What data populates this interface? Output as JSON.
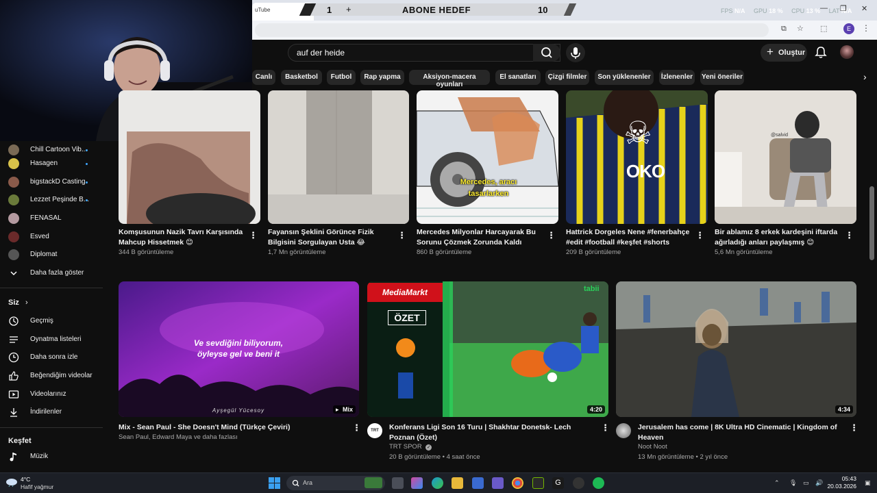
{
  "browser": {
    "tab_title": "uTube",
    "overlay": {
      "left_number": "1",
      "plus": "+",
      "title": "ABONE HEDEF",
      "right_number": "10"
    },
    "stats": [
      {
        "label": "FPS",
        "value": "N/A"
      },
      {
        "label": "GPU",
        "value": "18 %"
      },
      {
        "label": "CPU",
        "value": "13 %"
      },
      {
        "label": "LAT",
        "value": "N/A"
      }
    ],
    "profile_letter": "E"
  },
  "header": {
    "search_value": "auf der heide",
    "create_label": "Oluştur"
  },
  "chips": [
    "Canlı",
    "Basketbol",
    "Futbol",
    "Rap yapma",
    "Aksiyon-macera oyunları",
    "El sanatları",
    "Çizgi filmler",
    "Son yüklenenler",
    "İzlenenler",
    "Yeni öneriler"
  ],
  "sidebar": {
    "subscriptions": [
      {
        "label": "Chill Cartoon Vib...",
        "color": "#7a6a55"
      },
      {
        "label": "Hasagen",
        "color": "#d8c24a"
      },
      {
        "label": "bigstackD Casting",
        "color": "#8a5a4a"
      },
      {
        "label": "Lezzet Peşinde B...",
        "color": "#6a7a3a"
      },
      {
        "label": "FENASAL",
        "color": "#b49aa0"
      },
      {
        "label": "Esved",
        "color": "#6a2a2a"
      },
      {
        "label": "Diplomat",
        "color": "#555555"
      }
    ],
    "show_more": "Daha fazla göster",
    "you_heading": "Siz",
    "you_items": [
      {
        "label": "Geçmiş",
        "icon": "history-icon"
      },
      {
        "label": "Oynatma listeleri",
        "icon": "playlists-icon"
      },
      {
        "label": "Daha sonra izle",
        "icon": "watch-later-icon"
      },
      {
        "label": "Beğendiğim videolar",
        "icon": "like-icon"
      },
      {
        "label": "Videolarınız",
        "icon": "your-videos-icon"
      },
      {
        "label": "İndirilenler",
        "icon": "download-icon"
      }
    ],
    "explore_heading": "Keşfet",
    "explore_items": [
      {
        "label": "Müzik",
        "icon": "music-icon"
      }
    ]
  },
  "shorts": [
    {
      "title": "Komşusunun Nazik Tavrı Karşısında Mahcup Hissetmek 😊",
      "views": "344 B görüntüleme"
    },
    {
      "title": "Fayansın Şeklini Görünce Fizik Bilgisini Sorgulayan Usta 😂",
      "views": "1,7 Mn görüntüleme"
    },
    {
      "title": "Mercedes Milyonlar Harcayarak Bu Sorunu Çözmek Zorunda Kaldı",
      "views": "860 B görüntüleme",
      "overlay_text": "Mercedes, aracı tasarlarken"
    },
    {
      "title": "Hattrick Dorgeles Nene  #fenerbahçe #edit #football #keşfet #shorts",
      "views": "209 B görüntüleme",
      "overlay_text": "☠",
      "jersey_text": "OKO"
    },
    {
      "title": "Bir ablamız 8 erkek kardeşini iftarda ağırladığı anları paylaşmış 😊",
      "views": "5,6 Mn görüntüleme",
      "watermark": "@salvid"
    }
  ],
  "videos": [
    {
      "title": "Mix - Sean Paul - She Doesn't Mind (Türkçe Çeviri)",
      "meta1": "Sean Paul, Edward Maya ve daha fazlası",
      "meta2": "",
      "badge": "Mix",
      "lyric_line1": "Ve sevdiğini biliyorum,",
      "lyric_line2": "öyleyse gel ve beni it",
      "credit": "Ayşegül Yücesoy"
    },
    {
      "title": "Konferans Ligi Son 16 Turu | Shakhtar Donetsk- Lech Poznan (Özet)",
      "meta1": "TRT SPOR",
      "meta2": "20 B görüntüleme • 4 saat önce",
      "duration": "4:20",
      "brand": "MediaMarkt",
      "ozet": "ÖZET",
      "tabii": "tabii",
      "channel_avatar_text": "TRT"
    },
    {
      "title": "Jerusalem has come | 8K Ultra HD Cinematic | Kingdom of Heaven",
      "meta1": "Noot Noot",
      "meta2": "13 Mn görüntüleme • 2 yıl önce",
      "duration": "4:34"
    }
  ],
  "taskbar": {
    "temp": "4°C",
    "weather": "Hafif yağmur",
    "search_placeholder": "Ara",
    "time": "05:43",
    "date": "20.03.2026"
  }
}
